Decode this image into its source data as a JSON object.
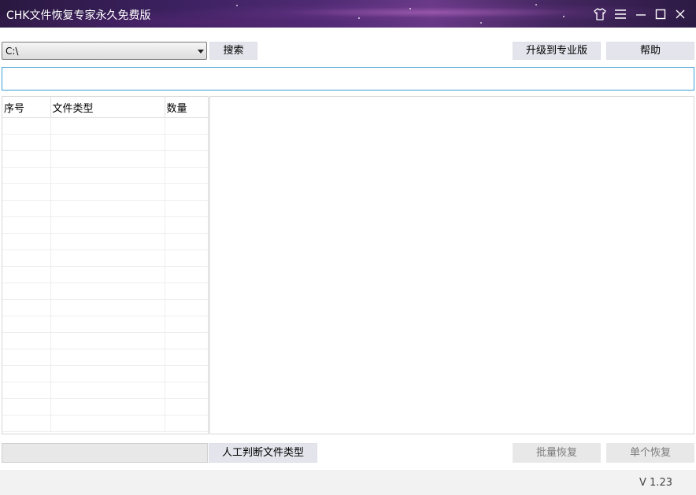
{
  "titlebar": {
    "title": "CHK文件恢复专家永久免费版",
    "controls": [
      "skin-icon",
      "menu-icon",
      "minimize-icon",
      "maximize-icon",
      "close-icon"
    ]
  },
  "toolbar": {
    "drive_selected": "C:\\",
    "search_label": "搜索",
    "upgrade_label": "升级到专业版",
    "help_label": "帮助"
  },
  "file_table": {
    "columns": [
      "序号",
      "文件类型",
      "数量"
    ],
    "rows": []
  },
  "bottom": {
    "manual_detect_label": "人工判断文件类型",
    "batch_recover_label": "批量恢复",
    "single_recover_label": "单个恢复"
  },
  "footer": {
    "version": "V 1.23"
  },
  "colors": {
    "title_gradient_dark": "#2a1840",
    "title_gradient_light": "#6a3a88",
    "button_bg": "#e4e4ec",
    "input_border": "#3c9fd6"
  }
}
